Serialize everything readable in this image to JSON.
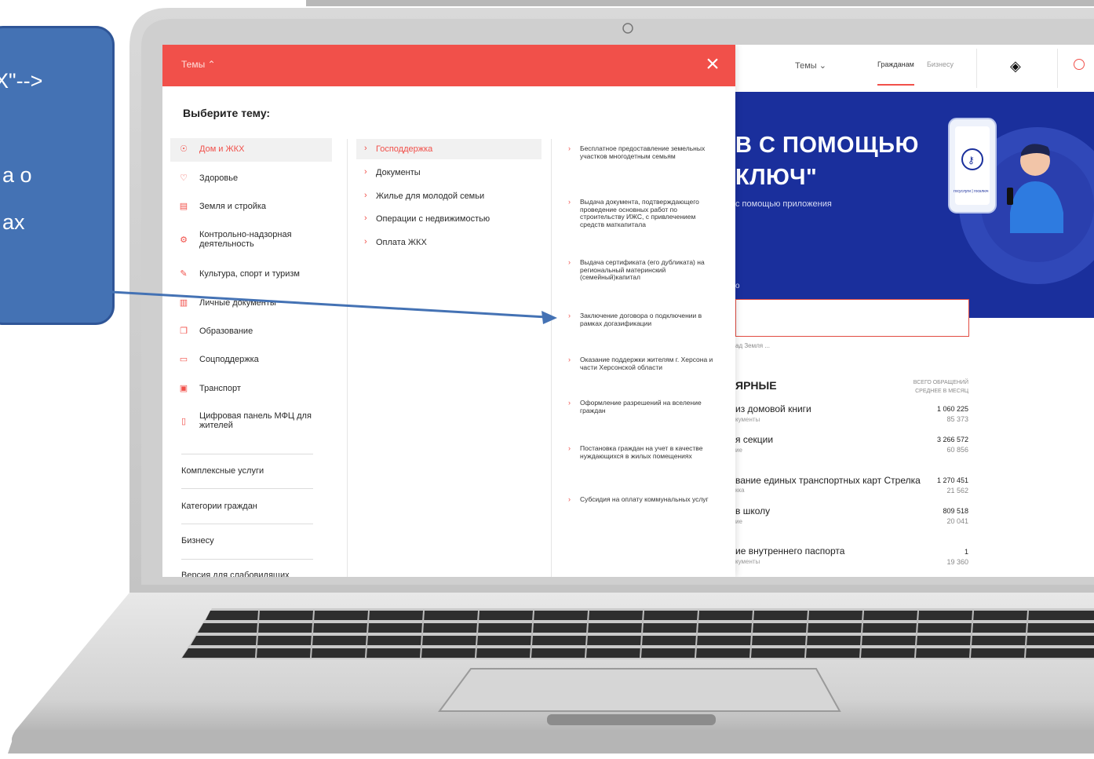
{
  "menu": {
    "bar_label": "Темы ⌃",
    "close_icon": "×",
    "choose_title": "Выберите тему:",
    "categories": [
      {
        "label": "Дом и ЖКХ",
        "icon": "bulb-icon",
        "glyph": "💡",
        "selected": true
      },
      {
        "label": "Здоровье",
        "icon": "heart-icon",
        "glyph": "♡"
      },
      {
        "label": "Земля и стройка",
        "icon": "building-icon",
        "glyph": "▤"
      },
      {
        "label": "Контрольно-надзорная деятельность",
        "icon": "gear-icon",
        "glyph": "⚙"
      },
      {
        "label": "Культура, спорт и туризм",
        "icon": "palette-icon",
        "glyph": "✎"
      },
      {
        "label": "Личные документы",
        "icon": "document-icon",
        "glyph": "▥"
      },
      {
        "label": "Образование",
        "icon": "book-icon",
        "glyph": "❐"
      },
      {
        "label": "Соцподдержка",
        "icon": "support-icon",
        "glyph": "▭"
      },
      {
        "label": "Транспорт",
        "icon": "bus-icon",
        "glyph": "▣"
      },
      {
        "label": "Цифровая панель МФЦ для жителей",
        "icon": "phone-icon",
        "glyph": "▯"
      }
    ],
    "extras": [
      "Комплексные услуги",
      "Категории граждан",
      "Бизнесу",
      "Версия для слабовидящих"
    ],
    "subtopics": [
      {
        "label": "Господдержка",
        "selected": true
      },
      {
        "label": "Документы"
      },
      {
        "label": "Жилье для молодой семьи"
      },
      {
        "label": "Операции с недвижимостью"
      },
      {
        "label": "Оплата ЖКХ"
      }
    ],
    "services": [
      "Бесплатное предоставление земельных участков многодетным семьям",
      "Выдача документа, подтверждающего проведение основных работ по строительству ИЖС, с привлечением средств маткапитала",
      "Выдача сертификата (его дубликата) на региональный материнский (семейный)капитал",
      "Заключение договора о подключении в рамках догазификации",
      "Оказание поддержки жителям г. Херсона и части Херсонской области",
      "Оформление разрешений на вселение граждан",
      "Постановка граждан на учет в качестве нуждающихся в жилых помещениях",
      "Субсидия на оплату коммунальных услуг"
    ]
  },
  "site": {
    "header_topics": "Темы ⌄",
    "header_citizens": "Гражданам",
    "header_business": "Бизнесу",
    "hero_line1": "В С ПОМОЩЬЮ",
    "hero_line2": "КЛЮЧ\"",
    "hero_sub": "с помощью приложения",
    "hero_o": "о",
    "phone_caption": "госуслуги | госключ",
    "tags": "ад Земля ...",
    "popular_title": "ЯРНЫЕ",
    "col_total": "ВСЕГО ОБРАЩЕНИЙ",
    "col_avg": "СРЕДНЕЕ В МЕСЯЦ",
    "rows": [
      {
        "name": "из домовой книги",
        "sub": "кументы",
        "total": "1 060 225",
        "avg": "85 373"
      },
      {
        "name": "я секции",
        "sub": "ие",
        "total": "3 266 572",
        "avg": "60 856"
      },
      {
        "name": "вание единых транспортных карт Стрелка",
        "sub": "кка",
        "total": "1 270 451",
        "avg": "21 562"
      },
      {
        "name": "в школу",
        "sub": "ие",
        "total": "809 518",
        "avg": "20 041"
      },
      {
        "name": "ие внутреннего паспорта",
        "sub": "кументы",
        "total": "1",
        "avg": "19 360"
      }
    ]
  },
  "callout": {
    "line1": "Х\"-->",
    "line2": "а о",
    "line3": "ах"
  }
}
